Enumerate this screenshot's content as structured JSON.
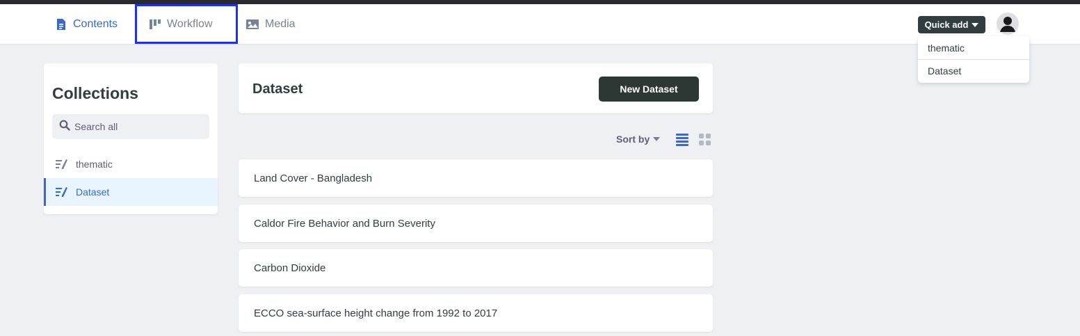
{
  "nav": {
    "tabs": [
      {
        "label": "Contents",
        "icon": "document-icon",
        "active": true
      },
      {
        "label": "Workflow",
        "icon": "workflow-icon",
        "active": false
      },
      {
        "label": "Media",
        "icon": "image-icon",
        "active": false
      }
    ],
    "quick_add_label": "Quick add",
    "quick_add_menu": [
      "thematic",
      "Dataset"
    ]
  },
  "sidebar": {
    "title": "Collections",
    "search_placeholder": "Search all",
    "items": [
      {
        "label": "thematic",
        "icon": "collection-icon",
        "active": false
      },
      {
        "label": "Dataset",
        "icon": "collection-icon",
        "active": true
      }
    ]
  },
  "main": {
    "title": "Dataset",
    "new_button_label": "New Dataset",
    "sort_label": "Sort by",
    "entries": [
      "Land Cover - Bangladesh",
      "Caldor Fire Behavior and Burn Severity",
      "Carbon Dioxide",
      "ECCO sea-surface height change from 1992 to 2017"
    ]
  },
  "colors": {
    "accent": "#3a69c7",
    "focus_outline": "#1b2ff5",
    "dark_button": "#2d3834",
    "background": "#eff0f4"
  }
}
